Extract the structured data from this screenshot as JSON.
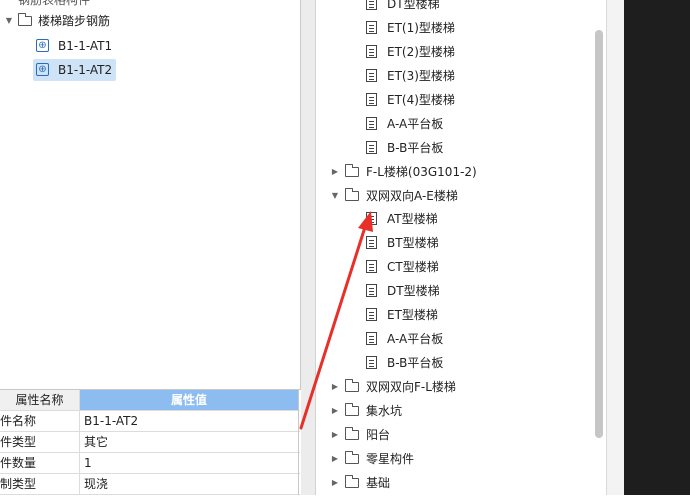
{
  "left_tree": {
    "top_partial": "钢筋表格构件",
    "group": "楼梯踏步钢筋",
    "items": [
      "B1-1-AT1",
      "B1-1-AT2"
    ]
  },
  "properties": {
    "header": {
      "name": "属性名称",
      "value": "属性值"
    },
    "rows": [
      {
        "name": "件名称",
        "value": "B1-1-AT2"
      },
      {
        "name": "件类型",
        "value": "其它"
      },
      {
        "name": "件数量",
        "value": "1"
      },
      {
        "name": "制类型",
        "value": "现浇"
      }
    ]
  },
  "right_tree": {
    "rows": [
      {
        "kind": "doc",
        "label": "DT型楼梯"
      },
      {
        "kind": "doc",
        "label": "ET(1)型楼梯"
      },
      {
        "kind": "doc",
        "label": "ET(2)型楼梯"
      },
      {
        "kind": "doc",
        "label": "ET(3)型楼梯"
      },
      {
        "kind": "doc",
        "label": "ET(4)型楼梯"
      },
      {
        "kind": "doc",
        "label": "A-A平台板"
      },
      {
        "kind": "doc",
        "label": "B-B平台板"
      },
      {
        "kind": "folder",
        "label": "F-L楼梯(03G101-2)",
        "expanded": false
      },
      {
        "kind": "folder",
        "label": "双网双向A-E楼梯",
        "expanded": true
      },
      {
        "kind": "doc",
        "label": "AT型楼梯"
      },
      {
        "kind": "doc",
        "label": "BT型楼梯"
      },
      {
        "kind": "doc",
        "label": "CT型楼梯"
      },
      {
        "kind": "doc",
        "label": "DT型楼梯"
      },
      {
        "kind": "doc",
        "label": "ET型楼梯"
      },
      {
        "kind": "doc",
        "label": "A-A平台板"
      },
      {
        "kind": "doc",
        "label": "B-B平台板"
      },
      {
        "kind": "folder",
        "label": "双网双向F-L楼梯",
        "expanded": false
      },
      {
        "kind": "folder",
        "label": "集水坑",
        "expanded": false
      },
      {
        "kind": "folder",
        "label": "阳台",
        "expanded": false
      },
      {
        "kind": "folder",
        "label": "零星构件",
        "expanded": false
      },
      {
        "kind": "folder",
        "label": "基础",
        "expanded": false
      }
    ]
  },
  "colors": {
    "selection": "#cfe3f7",
    "header_accent": "#8cbcf0",
    "annotation_arrow": "#e8302a"
  }
}
